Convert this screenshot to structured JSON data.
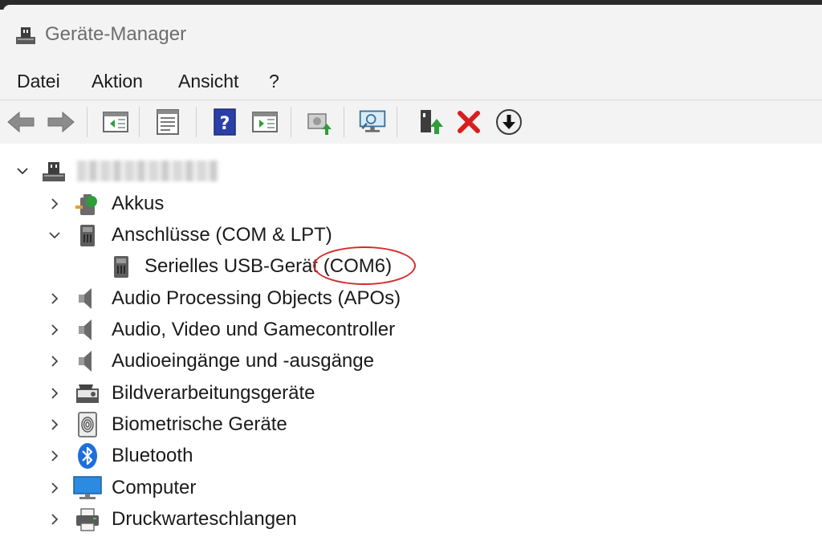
{
  "window": {
    "title": "Geräte-Manager"
  },
  "menu": [
    "Datei",
    "Aktion",
    "Ansicht",
    "?"
  ],
  "toolbar": [
    {
      "icon": "back-arrow-icon"
    },
    {
      "icon": "forward-arrow-icon"
    },
    {
      "icon": "show-hide-console-tree-icon"
    },
    {
      "icon": "properties-icon"
    },
    {
      "icon": "help-icon"
    },
    {
      "icon": "show-action-pane-icon"
    },
    {
      "icon": "update-driver-icon"
    },
    {
      "icon": "scan-hardware-changes-icon"
    },
    {
      "icon": "enable-device-icon"
    },
    {
      "icon": "uninstall-device-icon"
    },
    {
      "icon": "disable-device-icon"
    }
  ],
  "tree": {
    "root_label": "",
    "items": [
      {
        "label": "Akkus",
        "icon": "battery-icon",
        "expanded": false
      },
      {
        "label": "Anschlüsse (COM & LPT)",
        "icon": "port-icon",
        "expanded": true
      },
      {
        "label": "Serielles USB-Gerät (COM6)",
        "icon": "port-icon",
        "child": true
      },
      {
        "label": "Audio Processing Objects (APOs)",
        "icon": "speaker-icon",
        "expanded": false
      },
      {
        "label": "Audio, Video und Gamecontroller",
        "icon": "speaker-icon",
        "expanded": false
      },
      {
        "label": "Audioeingänge und -ausgänge",
        "icon": "speaker-icon",
        "expanded": false
      },
      {
        "label": "Bildverarbeitungsgeräte",
        "icon": "camera-icon",
        "expanded": false
      },
      {
        "label": "Biometrische Geräte",
        "icon": "fingerprint-icon",
        "expanded": false
      },
      {
        "label": "Bluetooth",
        "icon": "bluetooth-icon",
        "expanded": false
      },
      {
        "label": "Computer",
        "icon": "monitor-icon",
        "expanded": false
      },
      {
        "label": "Druckwarteschlangen",
        "icon": "printer-icon",
        "expanded": false
      }
    ]
  },
  "colors": {
    "highlight_circle": "#d42a2a",
    "accent_blue": "#1e6fd9"
  }
}
